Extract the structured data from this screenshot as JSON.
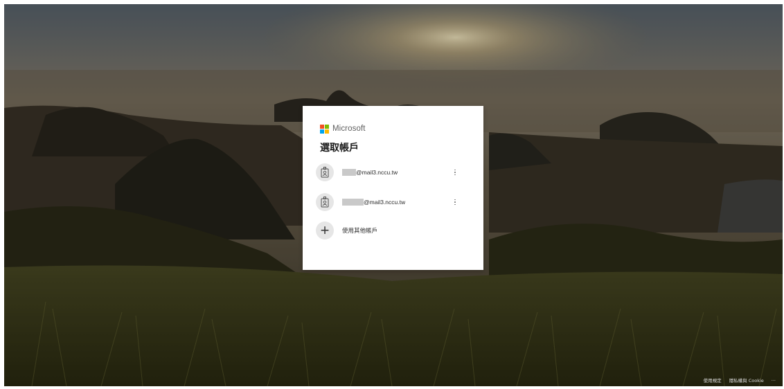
{
  "brand": {
    "name": "Microsoft",
    "logo_colors": [
      "#f25022",
      "#7fba00",
      "#00a4ef",
      "#ffb900"
    ]
  },
  "dialog": {
    "title": "選取帳戶",
    "accounts": [
      {
        "email_suffix": "@mail3.nccu.tw",
        "icon": "badge-person-icon"
      },
      {
        "email_suffix": "@mail3.nccu.tw",
        "icon": "badge-person-icon"
      }
    ],
    "add_account_label": "使用其他帳戶"
  },
  "footer": {
    "terms": "使用規定",
    "privacy": "隱私權與 Cookie",
    "more": "..."
  },
  "colors": {
    "card_bg": "#ffffff",
    "avatar_bg": "#e6e6e6"
  }
}
